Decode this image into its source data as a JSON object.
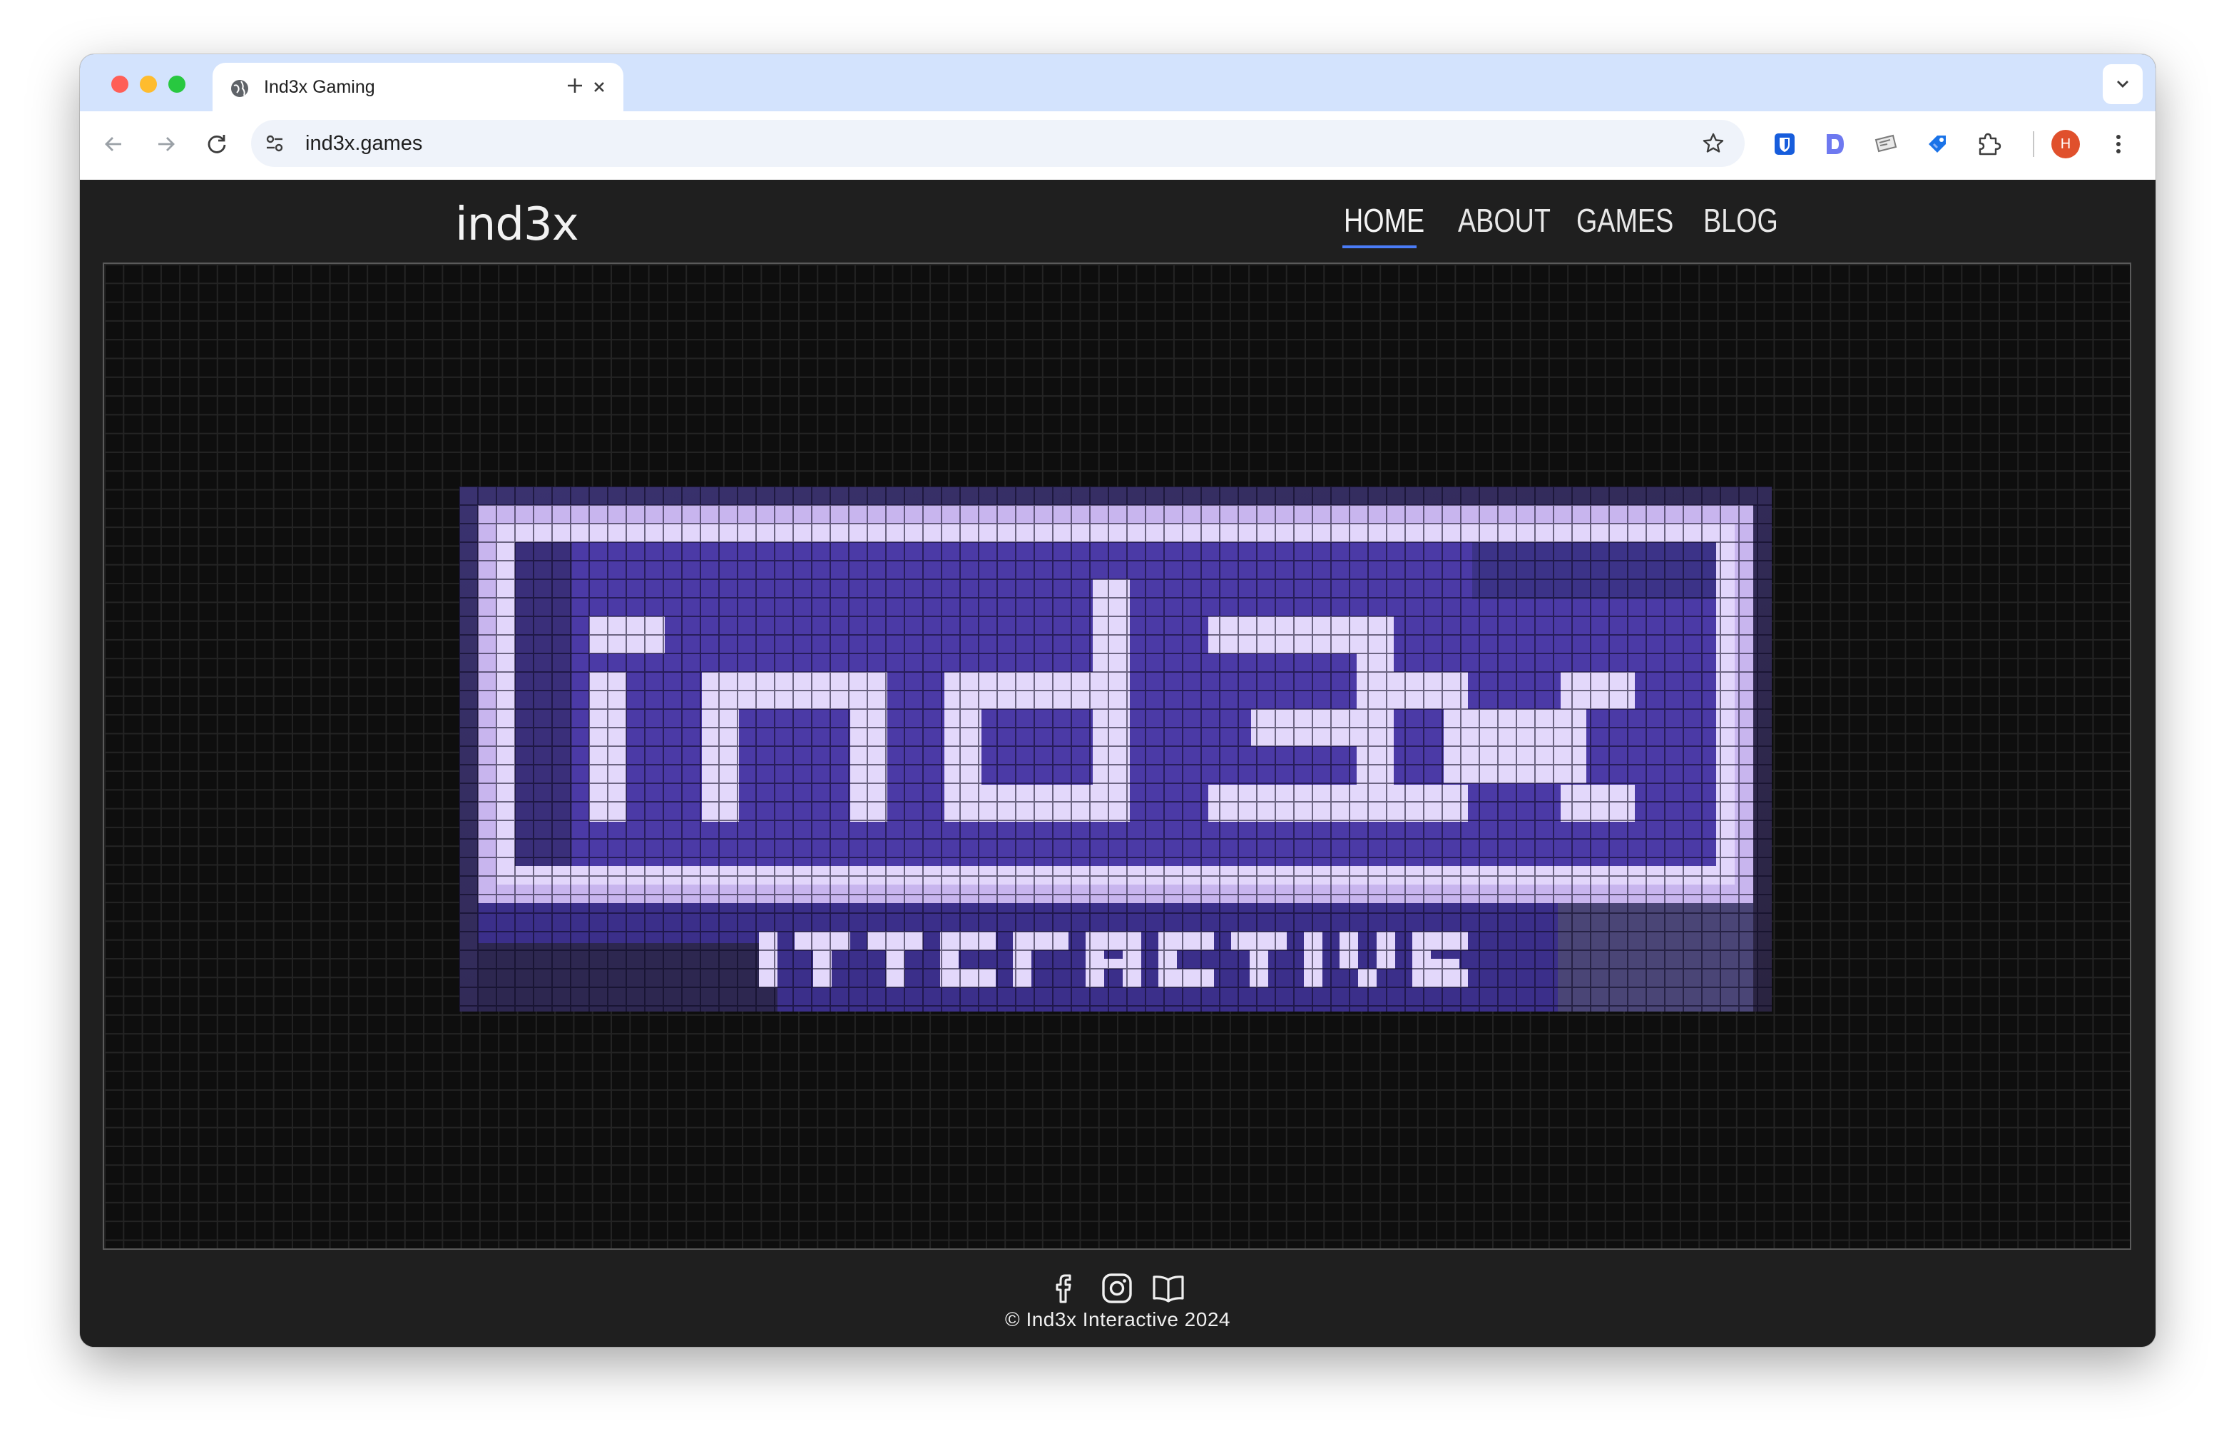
{
  "browser": {
    "tab_title": "Ind3x Gaming",
    "url": "ind3x.games",
    "profile_initial": "H",
    "icons": [
      "globe-icon",
      "close-icon",
      "plus-icon",
      "chevron-down-icon",
      "back-arrow-icon",
      "forward-arrow-icon",
      "reload-icon",
      "site-settings-icon",
      "star-icon",
      "bitwarden-icon",
      "extension-d-icon",
      "extension-card-icon",
      "extension-tag-icon",
      "puzzle-icon",
      "kebab-menu-icon"
    ]
  },
  "site": {
    "logo": "ind3x",
    "nav": [
      {
        "label": "HOME",
        "active": true
      },
      {
        "label": "ABOUT",
        "active": false
      },
      {
        "label": "GAMES",
        "active": false
      },
      {
        "label": "BLOG",
        "active": false
      }
    ],
    "accent_color": "#4a7cf7",
    "banner": {
      "image_label": "ind3x INTERACTIVE pixel-art logo",
      "colors": {
        "border": "#d8c8f2",
        "fill": "#4a3aa8",
        "letters": "#e3d8fb"
      }
    },
    "footer": {
      "social_icons": [
        "facebook-icon",
        "instagram-icon",
        "book-icon"
      ],
      "copyright": "© Ind3x Interactive 2024"
    }
  }
}
